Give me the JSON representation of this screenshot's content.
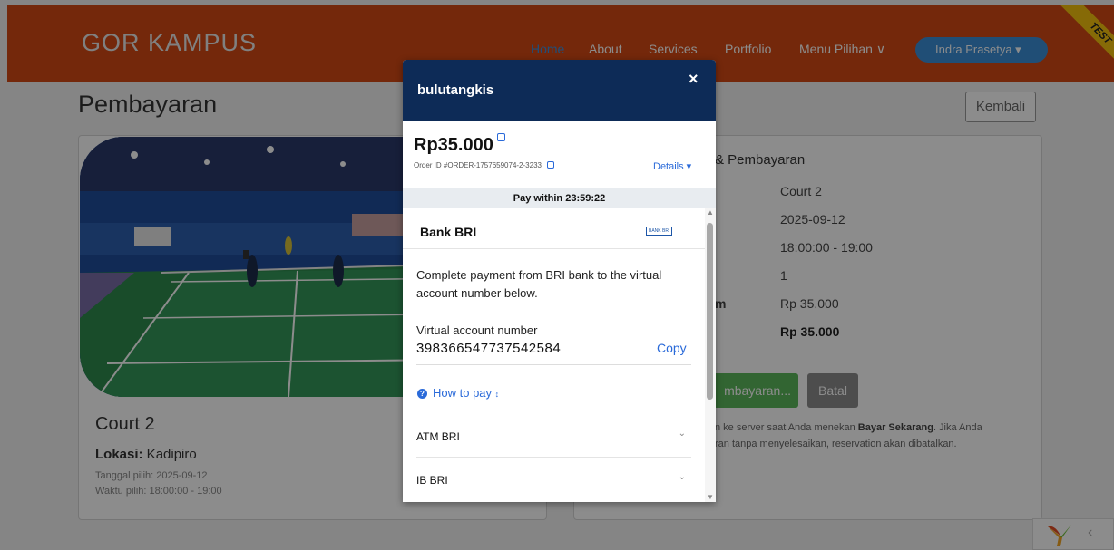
{
  "navbar": {
    "brand": "GOR KAMPUS",
    "links": [
      "Home",
      "About",
      "Services",
      "Portfolio",
      "Menu Pilihan ∨"
    ],
    "user": "Indra Prasetya ▾",
    "ribbon": "TEST"
  },
  "page": {
    "title": "Pembayaran",
    "back_button": "Kembali"
  },
  "court_card": {
    "name": "Court 2",
    "location_label": "Lokasi:",
    "location_value": " Kadipiro",
    "date_line": "Tanggal pilih: 2025-09-12",
    "time_line": "Waktu pilih: 18:00:00 - 19:00"
  },
  "summary": {
    "title": "& Pembayaran",
    "values": [
      "Court 2",
      "2025-09-12",
      "18:00:00 - 19:00",
      "1",
      "Rp 35.000",
      "Rp 35.000"
    ],
    "partial_label": "m",
    "pay_button": "mbayaran...",
    "cancel_button": "Batal",
    "notice_a": "n ke server saat Anda menekan ",
    "notice_bold": "Bayar Sekarang",
    "notice_b": ". Jika Anda",
    "notice_c": "ran tanpa menyelesaikan, reservation akan dibatalkan."
  },
  "modal": {
    "merchant": "bulutangkis",
    "close": "×",
    "amount": "Rp35.000",
    "order_id": "Order ID #ORDER-1757659074-2-3233",
    "details": "Details ▾",
    "pay_within_label": "Pay within",
    "pay_within_time": "23:59:22",
    "bank_name": "Bank BRI",
    "bank_logo": "BANK BRI",
    "instruction": "Complete payment from BRI bank to the virtual account number below.",
    "va_label": "Virtual account number",
    "va_number": "398366547737542584",
    "copy": "Copy",
    "how_to_pay": "How to pay",
    "how_to_pay_arrow": "↕",
    "methods": [
      "ATM BRI",
      "IB BRI"
    ]
  },
  "colors": {
    "navbar": "#d44a14",
    "modal_header": "#0d2b57",
    "link_blue": "#2a6ad9",
    "pay_green": "#5cb85c"
  }
}
